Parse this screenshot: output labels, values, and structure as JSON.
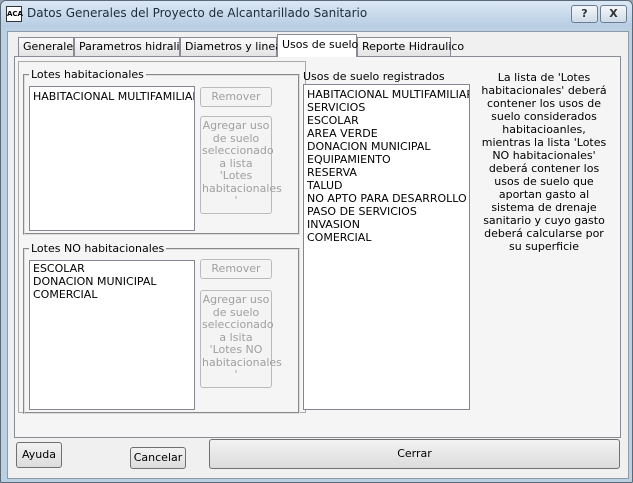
{
  "window": {
    "title": "Datos Generales del Proyecto de Alcantarillado Sanitario",
    "help_button": "?",
    "close_button": "X"
  },
  "tabs": [
    {
      "label": "Generales"
    },
    {
      "label": "Parametros hidralica"
    },
    {
      "label": "Diametros y lineas"
    },
    {
      "label": "Usos de suelo",
      "active": true
    },
    {
      "label": "Reporte Hidraulico"
    }
  ],
  "lotes_habitacionales": {
    "label": "Lotes habitacionales",
    "items": [
      "HABITACIONAL MULTIFAMILIAR"
    ],
    "remove_button": "Remover",
    "add_button": "Agregar uso de suelo seleccionado a lista 'Lotes habitacionales '"
  },
  "lotes_no_habitacionales": {
    "label": "Lotes NO habitacionales",
    "items": [
      "ESCOLAR",
      "DONACION MUNICIPAL",
      "COMERCIAL"
    ],
    "remove_button": "Remover",
    "add_button": "Agregar uso de suelo seleccionado a lsita 'Lotes NO habitacionales '"
  },
  "usos_registrados": {
    "label": "Usos de suelo registrados",
    "items": [
      "HABITACIONAL MULTIFAMILIAR",
      "SERVICIOS",
      "ESCOLAR",
      "AREA VERDE",
      "DONACION MUNICIPAL",
      "EQUIPAMIENTO",
      "RESERVA",
      "TALUD",
      "NO APTO PARA DESARROLLO",
      "PASO DE SERVICIOS",
      "INVASION",
      "COMERCIAL"
    ]
  },
  "help_text": "La lista de 'Lotes habitacionales' deberá contener los usos de suelo considerados habitacioanles, mientras la lista 'Lotes NO habitacionales' deberá contener los usos de suelo que aportan gasto al sistema de drenaje sanitario y cuyo gasto deberá calcularse por su superficie",
  "footer": {
    "help_button": "Ayuda",
    "cancel_button": "Cancelar",
    "close_button": "Cerrar"
  }
}
